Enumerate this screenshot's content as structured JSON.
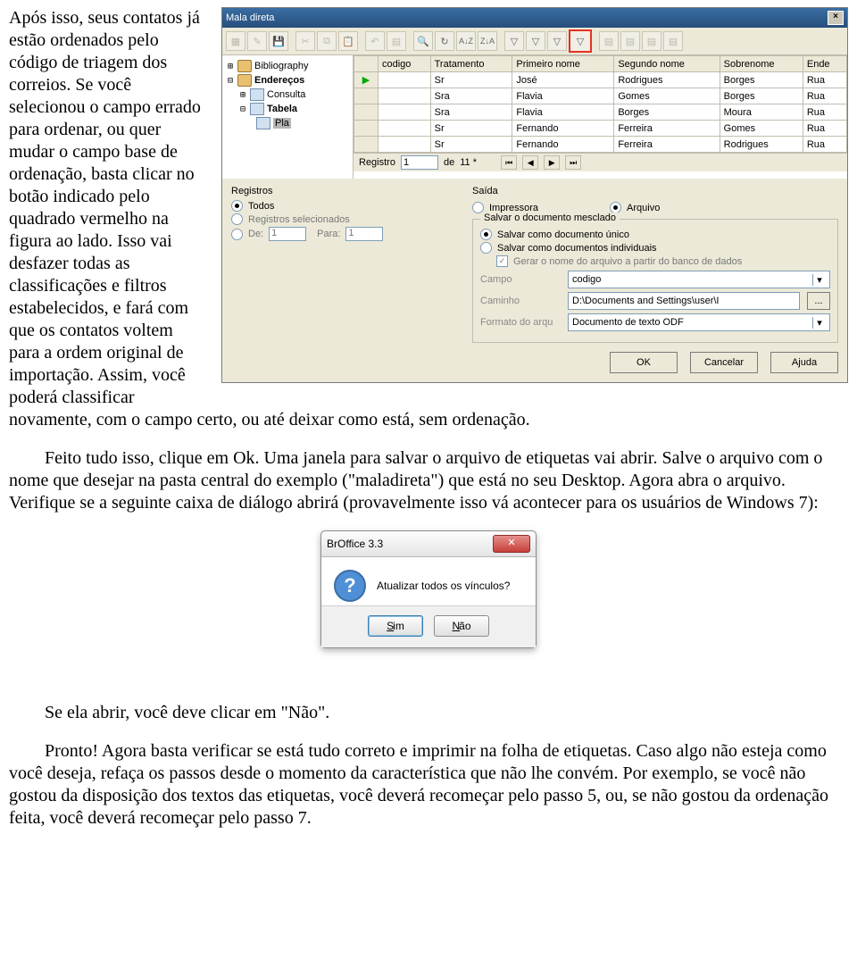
{
  "dlg": {
    "title": "Mala direta",
    "tree": {
      "bib": "Bibliography",
      "end": "Endereços",
      "cons": "Consulta",
      "tab": "Tabela",
      "plan": "Pla"
    },
    "headers": [
      "codigo",
      "Tratamento",
      "Primeiro nome",
      "Segundo nome",
      "Sobrenome",
      "Ende"
    ],
    "rows": [
      [
        "Sr",
        "José",
        "Rodrigues",
        "Borges",
        "Rua"
      ],
      [
        "Sra",
        "Flavia",
        "Gomes",
        "Borges",
        "Rua"
      ],
      [
        "Sra",
        "Flavia",
        "Borges",
        "Moura",
        "Rua"
      ],
      [
        "Sr",
        "Fernando",
        "Ferreira",
        "Gomes",
        "Rua"
      ],
      [
        "Sr",
        "Fernando",
        "Ferreira",
        "Rodrigues",
        "Rua"
      ]
    ],
    "rec": {
      "label": "Registro",
      "val": "1",
      "of": "de",
      "total": "11 *"
    },
    "reg": {
      "title": "Registros",
      "todos": "Todos",
      "sel": "Registros selecionados",
      "de": "De:",
      "de_v": "1",
      "para": "Para:",
      "para_v": "1"
    },
    "out": {
      "title": "Saída",
      "imp": "Impressora",
      "arq": "Arquivo"
    },
    "save": {
      "title": "Salvar o documento mesclado",
      "unico": "Salvar como documento único",
      "indiv": "Salvar como documentos individuais",
      "gerar": "Gerar o nome do arquivo a partir do banco de dados",
      "campo": "Campo",
      "campo_v": "codigo",
      "caminho": "Caminho",
      "caminho_v": "D:\\Documents and Settings\\user\\I",
      "formato": "Formato do arqu",
      "formato_v": "Documento de texto ODF"
    },
    "btns": {
      "ok": "OK",
      "cancel": "Cancelar",
      "help": "Ajuda"
    }
  },
  "msg": {
    "title": "BrOffice 3.3",
    "text": "Atualizar todos os vínculos?",
    "sim": "Sim",
    "nao": "Não"
  },
  "txt": {
    "p1": "Após isso, seus contatos já estão ordenados pelo código de triagem dos correios. Se você selecionou o campo errado para ordenar, ou quer mudar o campo base de ordenação, basta clicar no botão indicado pelo quadrado vermelho na figura ao lado. Isso vai desfazer todas as classificações e filtros estabelecidos, e fará com que os contatos voltem para a ordem original de importação. Assim, você poderá classificar novamente, com o campo certo, ou até deixar como está, sem ordenação.",
    "p2": "Feito tudo isso, clique em Ok. Uma janela para salvar o arquivo de etiquetas vai abrir. Salve o arquivo com o nome que desejar na pasta central do exemplo (\"maladireta\") que está no seu Desktop. Agora abra o arquivo. Verifique se a seguinte caixa de diálogo abrirá (provavelmente isso vá acontecer para os usuários de Windows 7):",
    "p3": "Se ela abrir, você deve clicar em \"Não\".",
    "p4": "Pronto! Agora basta verificar se está tudo correto e imprimir na folha de etiquetas. Caso algo não esteja como você deseja, refaça os passos desde o momento da característica que não lhe convém. Por exemplo, se você não gostou da disposição dos textos das etiquetas, você deverá recomeçar pelo passo 5, ou, se não gostou da ordenação feita, você deverá recomeçar pelo passo 7."
  }
}
